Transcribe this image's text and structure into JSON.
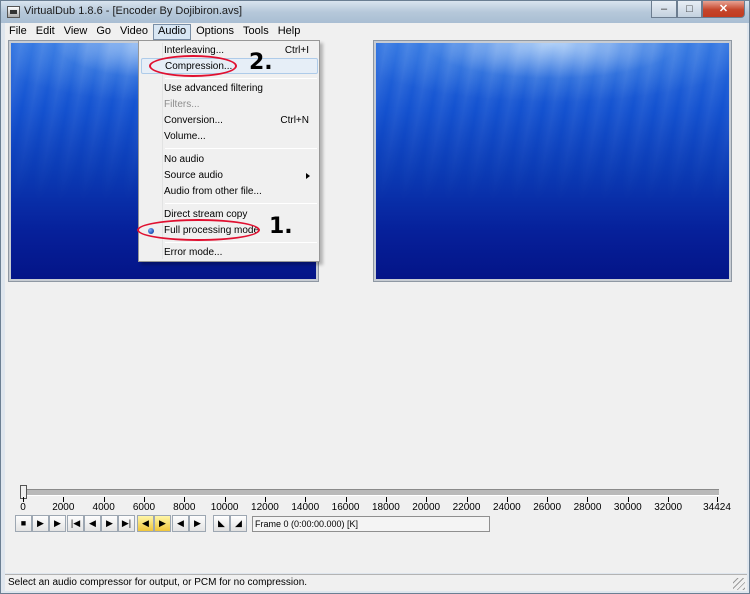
{
  "window": {
    "title": "VirtualDub 1.8.6 - [Encoder By Dojibiron.avs]",
    "controls": {
      "minimize": "–",
      "maximize": "□",
      "close": "✕"
    }
  },
  "menubar": {
    "items": [
      {
        "label": "File"
      },
      {
        "label": "Edit"
      },
      {
        "label": "View"
      },
      {
        "label": "Go"
      },
      {
        "label": "Video"
      },
      {
        "label": "Audio",
        "active": true
      },
      {
        "label": "Options"
      },
      {
        "label": "Tools"
      },
      {
        "label": "Help"
      }
    ]
  },
  "audio_menu": {
    "items": [
      {
        "label": "Interleaving...",
        "shortcut": "Ctrl+I"
      },
      {
        "label": "Compression...",
        "highlighted": true
      },
      {
        "label": "Use advanced filtering"
      },
      {
        "label": "Filters...",
        "disabled": true
      },
      {
        "label": "Conversion...",
        "shortcut": "Ctrl+N"
      },
      {
        "label": "Volume..."
      },
      {
        "label": "No audio"
      },
      {
        "label": "Source audio",
        "submenu": true
      },
      {
        "label": "Audio from other file..."
      },
      {
        "label": "Direct stream copy"
      },
      {
        "label": "Full processing mode",
        "checked": true
      },
      {
        "label": "Error mode..."
      }
    ]
  },
  "annotations": {
    "step1": "1.",
    "step2": "2.",
    "color": "#e01030"
  },
  "timeline": {
    "tick_labels": [
      "0",
      "2000",
      "4000",
      "6000",
      "8000",
      "10000",
      "12000",
      "14000",
      "16000",
      "18000",
      "20000",
      "22000",
      "24000",
      "26000",
      "28000",
      "30000",
      "32000",
      "34424"
    ],
    "position_frame": 0,
    "total_frames": 34424
  },
  "toolbar": {
    "buttons": [
      "stop",
      "play-input",
      "play-output",
      "start",
      "prev-frame",
      "next-frame",
      "end",
      "prev-keyframe",
      "next-keyframe",
      "scene-back",
      "scene-forward",
      "mark-in",
      "mark-out"
    ],
    "glyphs": [
      "■",
      "▶",
      "▶",
      "|◀",
      "◀",
      "▶",
      "▶|",
      "◀",
      "▶",
      "◀",
      "▶",
      "◣",
      "◢"
    ],
    "frame_text": "Frame 0 (0:00:00.000) [K]"
  },
  "status": {
    "text": "Select an audio compressor for output, or PCM for no compression."
  },
  "colors": {
    "video_blue": "#0b3ab4",
    "menu_bg": "#f0f0f0",
    "highlight": "#e6eef7"
  }
}
